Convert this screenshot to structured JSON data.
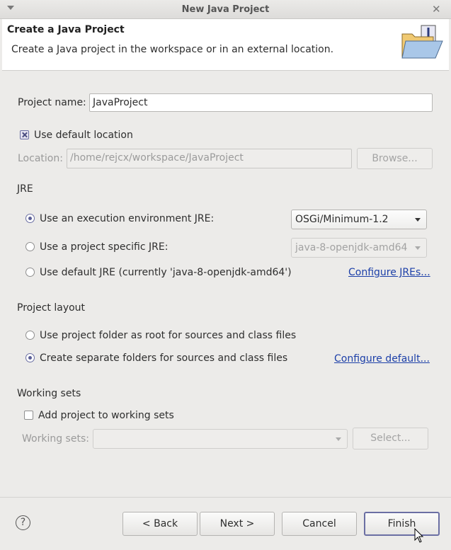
{
  "window": {
    "title": "New Java Project"
  },
  "banner": {
    "title": "Create a Java Project",
    "description": "Create a Java project in the workspace or in an external location.",
    "icon": "java-project-folder-icon"
  },
  "project": {
    "name_label": "Project name:",
    "name_value": "JavaProject"
  },
  "location": {
    "use_default_label": "Use default location",
    "use_default_checked": true,
    "label": "Location:",
    "value": "/home/rejcx/workspace/JavaProject",
    "browse_label": "Browse..."
  },
  "jre": {
    "section_label": "JRE",
    "exec_env_label": "Use an execution environment JRE:",
    "exec_env_value": "OSGi/Minimum-1.2",
    "project_specific_label": "Use a project specific JRE:",
    "project_specific_value": "java-8-openjdk-amd64",
    "default_label": "Use default JRE (currently 'java-8-openjdk-amd64')",
    "configure_link": "Configure JREs...",
    "selected": "exec_env"
  },
  "layout": {
    "section_label": "Project layout",
    "root_label": "Use project folder as root for sources and class files",
    "separate_label": "Create separate folders for sources and class files",
    "configure_link": "Configure default...",
    "selected": "separate"
  },
  "working_sets": {
    "section_label": "Working sets",
    "add_label": "Add project to working sets",
    "add_checked": false,
    "sets_label": "Working sets:",
    "sets_value": "",
    "select_label": "Select..."
  },
  "buttons": {
    "back": "< Back",
    "next": "Next >",
    "cancel": "Cancel",
    "finish": "Finish"
  },
  "colors": {
    "accent": "#6b6fa3",
    "link": "#1c3fa8",
    "dialog_bg": "#ecebe9"
  }
}
